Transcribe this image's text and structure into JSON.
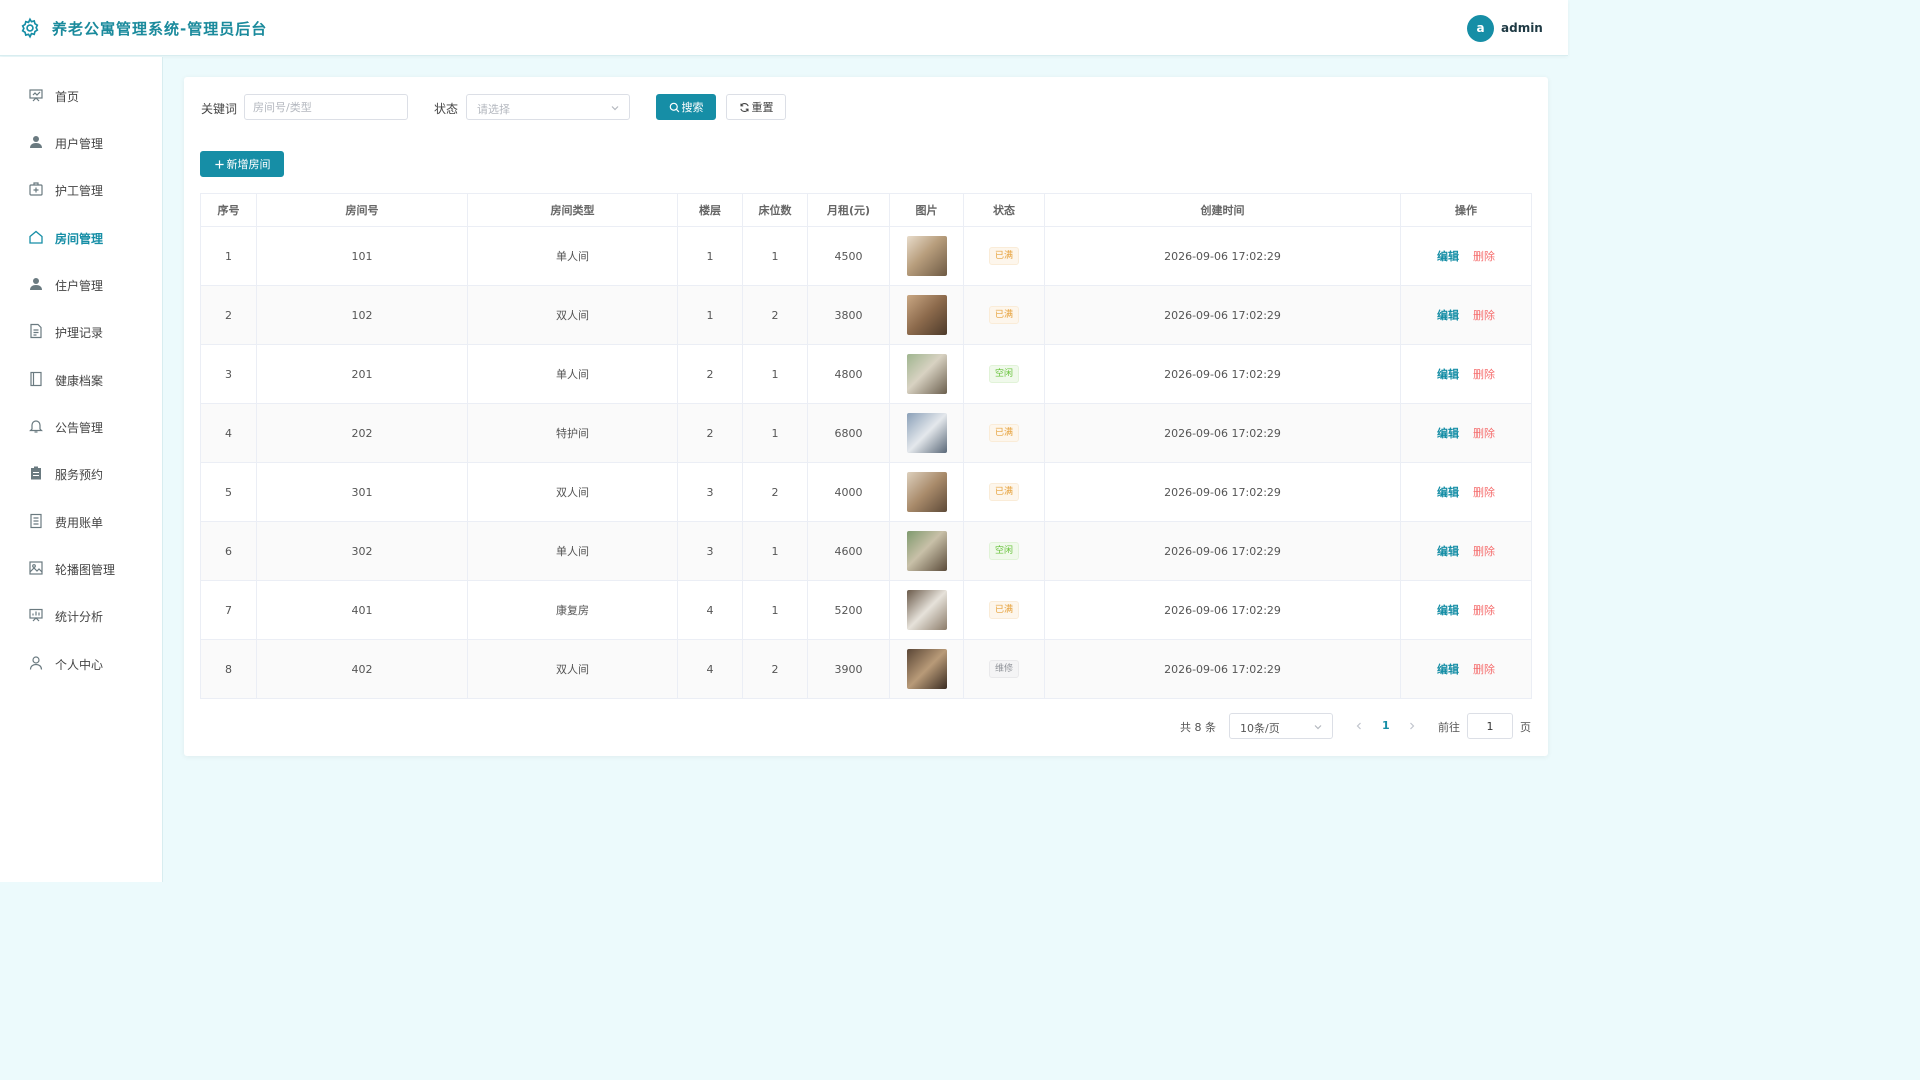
{
  "header": {
    "title": "养老公寓管理系统-管理员后台",
    "avatar_letter": "a",
    "username": "admin"
  },
  "sidebar": {
    "items": [
      {
        "label": "首页",
        "icon": "dashboard-icon"
      },
      {
        "label": "用户管理",
        "icon": "user-icon"
      },
      {
        "label": "护工管理",
        "icon": "medical-kit-icon"
      },
      {
        "label": "房间管理",
        "icon": "house-icon",
        "active": true
      },
      {
        "label": "住户管理",
        "icon": "user-icon"
      },
      {
        "label": "护理记录",
        "icon": "document-icon"
      },
      {
        "label": "健康档案",
        "icon": "notebook-icon"
      },
      {
        "label": "公告管理",
        "icon": "bell-icon"
      },
      {
        "label": "服务预约",
        "icon": "clipboard-icon"
      },
      {
        "label": "费用账单",
        "icon": "receipt-icon"
      },
      {
        "label": "轮播图管理",
        "icon": "picture-icon"
      },
      {
        "label": "统计分析",
        "icon": "presentation-icon"
      },
      {
        "label": "个人中心",
        "icon": "person-outline-icon"
      }
    ]
  },
  "filters": {
    "keyword_label": "关键词",
    "keyword_placeholder": "房间号/类型",
    "status_label": "状态",
    "status_placeholder": "请选择",
    "search_label": "搜索",
    "reset_label": "重置"
  },
  "toolbar": {
    "add_label": "新增房间"
  },
  "table": {
    "columns": [
      "序号",
      "房间号",
      "房间类型",
      "楼层",
      "床位数",
      "月租(元)",
      "图片",
      "状态",
      "创建时间",
      "操作"
    ],
    "rows": [
      {
        "index": "1",
        "room_no": "101",
        "type": "单人间",
        "floor": "1",
        "beds": "1",
        "rent": "4500",
        "status": "已满",
        "created": "2026-09-06 17:02:29"
      },
      {
        "index": "2",
        "room_no": "102",
        "type": "双人间",
        "floor": "1",
        "beds": "2",
        "rent": "3800",
        "status": "已满",
        "created": "2026-09-06 17:02:29"
      },
      {
        "index": "3",
        "room_no": "201",
        "type": "单人间",
        "floor": "2",
        "beds": "1",
        "rent": "4800",
        "status": "空闲",
        "created": "2026-09-06 17:02:29"
      },
      {
        "index": "4",
        "room_no": "202",
        "type": "特护间",
        "floor": "2",
        "beds": "1",
        "rent": "6800",
        "status": "已满",
        "created": "2026-09-06 17:02:29"
      },
      {
        "index": "5",
        "room_no": "301",
        "type": "双人间",
        "floor": "3",
        "beds": "2",
        "rent": "4000",
        "status": "已满",
        "created": "2026-09-06 17:02:29"
      },
      {
        "index": "6",
        "room_no": "302",
        "type": "单人间",
        "floor": "3",
        "beds": "1",
        "rent": "4600",
        "status": "空闲",
        "created": "2026-09-06 17:02:29"
      },
      {
        "index": "7",
        "room_no": "401",
        "type": "康复房",
        "floor": "4",
        "beds": "1",
        "rent": "5200",
        "status": "已满",
        "created": "2026-09-06 17:02:29"
      },
      {
        "index": "8",
        "room_no": "402",
        "type": "双人间",
        "floor": "4",
        "beds": "2",
        "rent": "3900",
        "status": "维修",
        "created": "2026-09-06 17:02:29"
      }
    ],
    "edit_label": "编辑",
    "delete_label": "删除"
  },
  "pagination": {
    "total_text": "共 8 条",
    "page_size": "10条/页",
    "current_page": "1",
    "goto_label": "前往",
    "goto_value": "1",
    "page_suffix": "页"
  },
  "colors": {
    "accent": "#168ea6",
    "background": "#ecfafc",
    "status_full": "#e6a23c",
    "status_free": "#67c23a",
    "status_repair": "#909399",
    "delete": "#f56c6c"
  }
}
